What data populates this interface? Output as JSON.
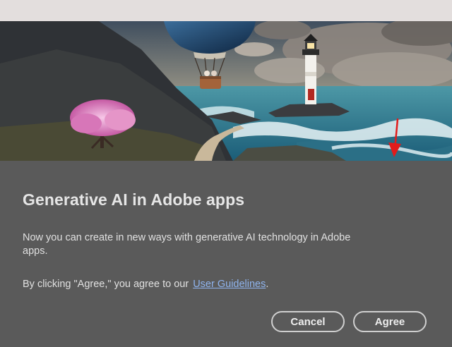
{
  "dialog": {
    "title": "Generative AI in Adobe apps",
    "description": "Now you can create in new ways with generative AI technology in Adobe apps.",
    "agreement_prefix": "By clicking \"Agree,\" you agree to our",
    "agreement_link": "User Guidelines",
    "agreement_suffix": ".",
    "buttons": {
      "cancel": "Cancel",
      "agree": "Agree"
    }
  },
  "hero_image": {
    "subject": "lighthouse-balloon-landscape"
  },
  "colors": {
    "dialog_background": "#5a5a5a",
    "titlebar": "#e3dedd",
    "link": "#8fb4ee",
    "annotation_arrow": "#e21b1b"
  }
}
